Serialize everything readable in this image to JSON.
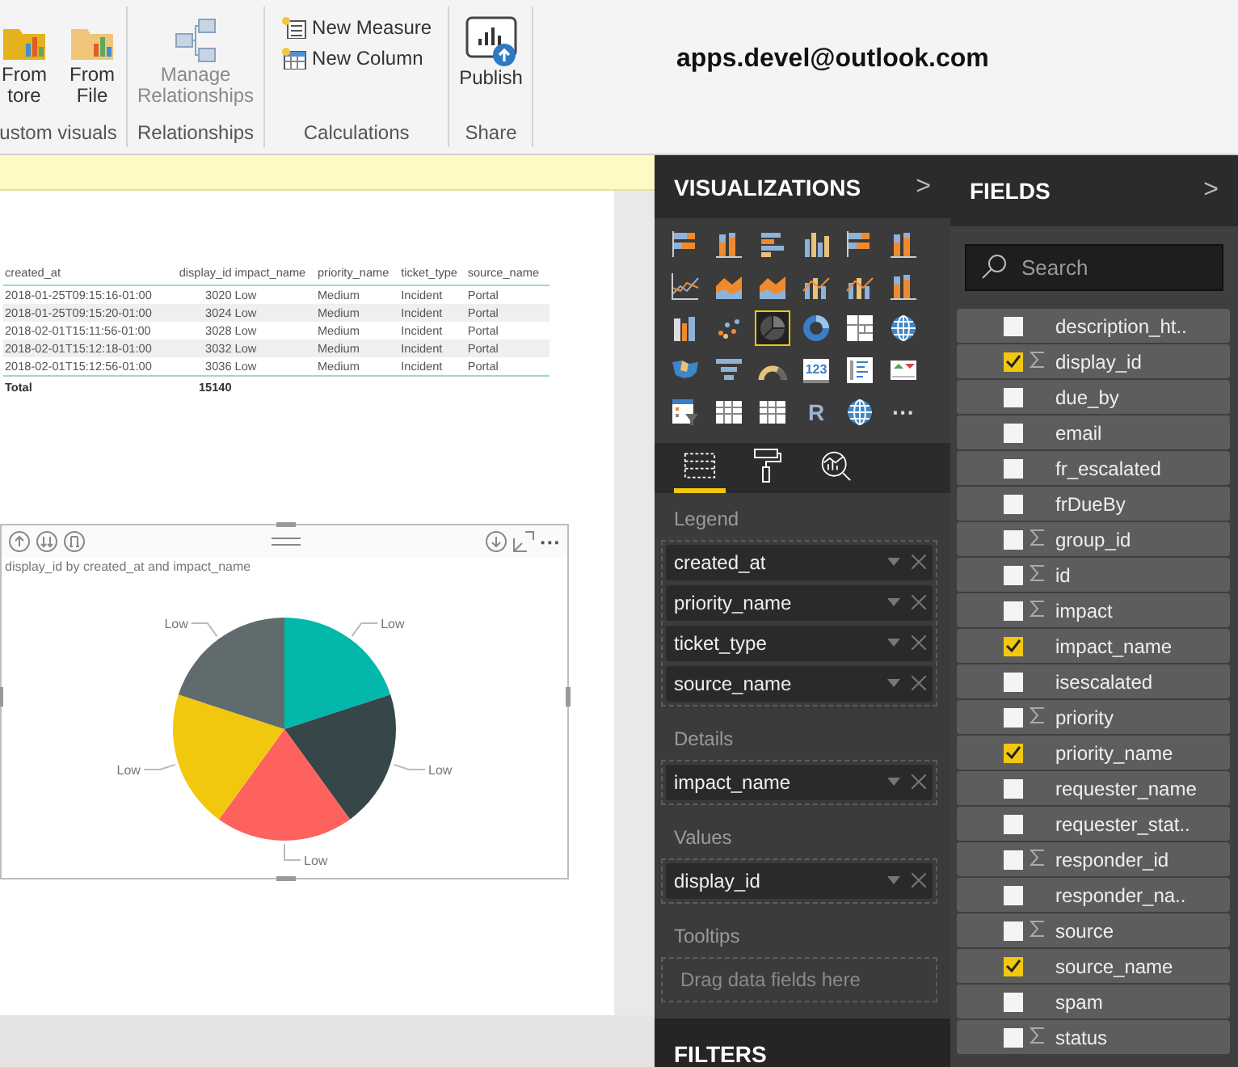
{
  "ribbon": {
    "groups": [
      {
        "label": "ustom visuals",
        "buttons": [
          {
            "kind": "store",
            "lines": [
              "From",
              "tore"
            ]
          },
          {
            "kind": "file",
            "lines": [
              "From",
              "File"
            ]
          }
        ]
      },
      {
        "label": "Relationships",
        "buttons": [
          {
            "kind": "relationships",
            "lines": [
              "Manage",
              "Relationships"
            ],
            "disabled": true
          }
        ]
      },
      {
        "label": "Calculations",
        "small_buttons": [
          {
            "kind": "measure",
            "label": "New Measure"
          },
          {
            "kind": "column",
            "label": "New Column"
          }
        ]
      },
      {
        "label": "Share",
        "buttons": [
          {
            "kind": "publish",
            "lines": [
              "Publish"
            ]
          }
        ]
      }
    ],
    "account": "apps.devel@outlook.com"
  },
  "table": {
    "columns": [
      "created_at",
      "display_id",
      "impact_name",
      "priority_name",
      "ticket_type",
      "source_name"
    ],
    "rows": [
      [
        "2018-01-25T09:15:16-01:00",
        "3020",
        "Low",
        "Medium",
        "Incident",
        "Portal"
      ],
      [
        "2018-01-25T09:15:20-01:00",
        "3024",
        "Low",
        "Medium",
        "Incident",
        "Portal"
      ],
      [
        "2018-02-01T15:11:56-01:00",
        "3028",
        "Low",
        "Medium",
        "Incident",
        "Portal"
      ],
      [
        "2018-02-01T15:12:18-01:00",
        "3032",
        "Low",
        "Medium",
        "Incident",
        "Portal"
      ],
      [
        "2018-02-01T15:12:56-01:00",
        "3036",
        "Low",
        "Medium",
        "Incident",
        "Portal"
      ]
    ],
    "total": [
      "Total",
      "15140"
    ]
  },
  "visual": {
    "title": "display_id by created_at and impact_name",
    "more": "···",
    "slices": [
      {
        "label": "Low",
        "color": "#01b8aa"
      },
      {
        "label": "Low",
        "color": "#374649"
      },
      {
        "label": "Low",
        "color": "#fd625e"
      },
      {
        "label": "Low",
        "color": "#f2c80f"
      },
      {
        "label": "Low",
        "color": "#5f6b6d"
      }
    ]
  },
  "visualizations": {
    "title": "VISUALIZATIONS",
    "icons": [
      {
        "kind": "hbar",
        "selected": false
      },
      {
        "kind": "vbar",
        "selected": false
      },
      {
        "kind": "hbar2",
        "selected": false
      },
      {
        "kind": "vbar2",
        "selected": false
      },
      {
        "kind": "hbar",
        "selected": false
      },
      {
        "kind": "vbar",
        "selected": false
      },
      {
        "kind": "line",
        "selected": false
      },
      {
        "kind": "area",
        "selected": false
      },
      {
        "kind": "area",
        "selected": false
      },
      {
        "kind": "combo",
        "selected": false
      },
      {
        "kind": "combo",
        "selected": false
      },
      {
        "kind": "vbar",
        "selected": false
      },
      {
        "kind": "ribbon",
        "selected": false
      },
      {
        "kind": "scatter",
        "selected": false
      },
      {
        "kind": "pie",
        "selected": true
      },
      {
        "kind": "donut",
        "selected": false
      },
      {
        "kind": "treemap",
        "selected": false
      },
      {
        "kind": "globe",
        "selected": false
      },
      {
        "kind": "map",
        "selected": false
      },
      {
        "kind": "funnel",
        "selected": false
      },
      {
        "kind": "gauge",
        "selected": false
      },
      {
        "kind": "card",
        "label": "123",
        "selected": false
      },
      {
        "kind": "multirow",
        "selected": false
      },
      {
        "kind": "kpi",
        "selected": false
      },
      {
        "kind": "slicer",
        "selected": false
      },
      {
        "kind": "table",
        "selected": false
      },
      {
        "kind": "table",
        "selected": false
      },
      {
        "kind": "letter",
        "label": "R",
        "selected": false
      },
      {
        "kind": "globe",
        "selected": false
      },
      {
        "kind": "more",
        "label": "···",
        "selected": false
      }
    ],
    "tabs": [
      {
        "kind": "fields",
        "selected": true
      },
      {
        "kind": "format",
        "selected": false
      },
      {
        "kind": "analytics",
        "selected": false
      }
    ],
    "wells": [
      {
        "title": "Legend",
        "fields": [
          "created_at",
          "priority_name",
          "ticket_type",
          "source_name"
        ]
      },
      {
        "title": "Details",
        "fields": [
          "impact_name"
        ]
      },
      {
        "title": "Values",
        "fields": [
          "display_id"
        ]
      },
      {
        "title": "Tooltips",
        "placeholder": "Drag data fields here"
      }
    ],
    "filters_title": "FILTERS",
    "collapse": ">"
  },
  "fields": {
    "title": "FIELDS",
    "collapse": ">",
    "search_placeholder": "Search",
    "items": [
      {
        "name": "description_ht..",
        "checked": false,
        "sum": false
      },
      {
        "name": "display_id",
        "checked": true,
        "sum": true
      },
      {
        "name": "due_by",
        "checked": false,
        "sum": false
      },
      {
        "name": "email",
        "checked": false,
        "sum": false
      },
      {
        "name": "fr_escalated",
        "checked": false,
        "sum": false
      },
      {
        "name": "frDueBy",
        "checked": false,
        "sum": false
      },
      {
        "name": "group_id",
        "checked": false,
        "sum": true
      },
      {
        "name": "id",
        "checked": false,
        "sum": true
      },
      {
        "name": "impact",
        "checked": false,
        "sum": true
      },
      {
        "name": "impact_name",
        "checked": true,
        "sum": false
      },
      {
        "name": "isescalated",
        "checked": false,
        "sum": false
      },
      {
        "name": "priority",
        "checked": false,
        "sum": true
      },
      {
        "name": "priority_name",
        "checked": true,
        "sum": false
      },
      {
        "name": "requester_name",
        "checked": false,
        "sum": false
      },
      {
        "name": "requester_stat..",
        "checked": false,
        "sum": false
      },
      {
        "name": "responder_id",
        "checked": false,
        "sum": true
      },
      {
        "name": "responder_na..",
        "checked": false,
        "sum": false
      },
      {
        "name": "source",
        "checked": false,
        "sum": true
      },
      {
        "name": "source_name",
        "checked": true,
        "sum": false
      },
      {
        "name": "spam",
        "checked": false,
        "sum": false
      },
      {
        "name": "status",
        "checked": false,
        "sum": true
      }
    ]
  }
}
